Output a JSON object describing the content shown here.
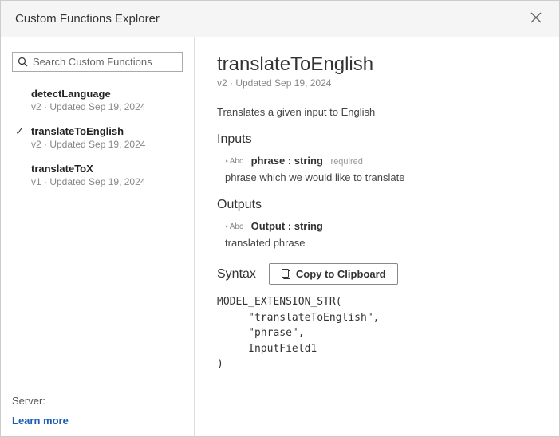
{
  "title": "Custom Functions Explorer",
  "search": {
    "placeholder": "Search Custom Functions"
  },
  "functions": [
    {
      "name": "detectLanguage",
      "meta": "v2 · Updated Sep 19, 2024",
      "selected": false
    },
    {
      "name": "translateToEnglish",
      "meta": "v2 · Updated Sep 19, 2024",
      "selected": true
    },
    {
      "name": "translateToX",
      "meta": "v1 · Updated Sep 19, 2024",
      "selected": false
    }
  ],
  "server": {
    "label": "Server:",
    "learn_more": "Learn more"
  },
  "detail": {
    "title": "translateToEnglish",
    "meta": "v2 · Updated Sep 19, 2024",
    "description": "Translates a given input to English",
    "inputs_heading": "Inputs",
    "input": {
      "type_glyph": "Abc",
      "name": "phrase",
      "colon": " : ",
      "type": "string",
      "required": "required",
      "desc": "phrase which we would like to translate"
    },
    "outputs_heading": "Outputs",
    "output": {
      "type_glyph": "Abc",
      "name": "Output",
      "colon": " : ",
      "type": "string",
      "desc": "translated phrase"
    },
    "syntax_heading": "Syntax",
    "copy_label": "Copy to Clipboard",
    "code": "MODEL_EXTENSION_STR(\n     \"translateToEnglish\",\n     \"phrase\",\n     InputField1\n)"
  }
}
